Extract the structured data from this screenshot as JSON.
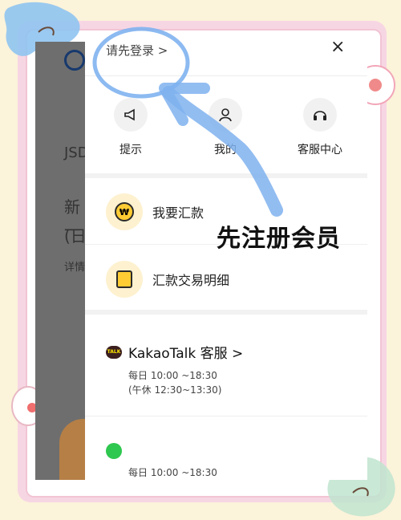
{
  "background_app": {
    "line1": "JSD",
    "line2": "新⼀",
    "line3": "(日",
    "line4": "详情"
  },
  "drawer": {
    "login_prompt": "请先登录 >",
    "close_icon": "×",
    "quick_actions": [
      {
        "label": "提示",
        "icon": "megaphone-icon"
      },
      {
        "label": "我的",
        "icon": "person-icon"
      },
      {
        "label": "客服中心",
        "icon": "headset-icon"
      }
    ],
    "menu": [
      {
        "label": "我要汇款",
        "icon": "won-coin-icon",
        "icon_text": "₩"
      },
      {
        "label": "汇款交易明细",
        "icon": "receipt-icon"
      }
    ],
    "contacts": [
      {
        "title": "KakaoTalk 客服 >",
        "badge": "TALK",
        "hours_1": "每日 10:00 ~18:30",
        "hours_2": "(午休 12:30~13:30)"
      },
      {
        "title": "",
        "badge": "",
        "hours_1": "每日 10:00 ~18:30",
        "hours_2": ""
      }
    ]
  },
  "overlay": {
    "caption": "先注册会员",
    "annotation_color": "#7fb2ef"
  },
  "colors": {
    "frame_pink": "#f7d6e3",
    "page_cream": "#fbf3da",
    "accent_yellow": "#ffcc33"
  }
}
